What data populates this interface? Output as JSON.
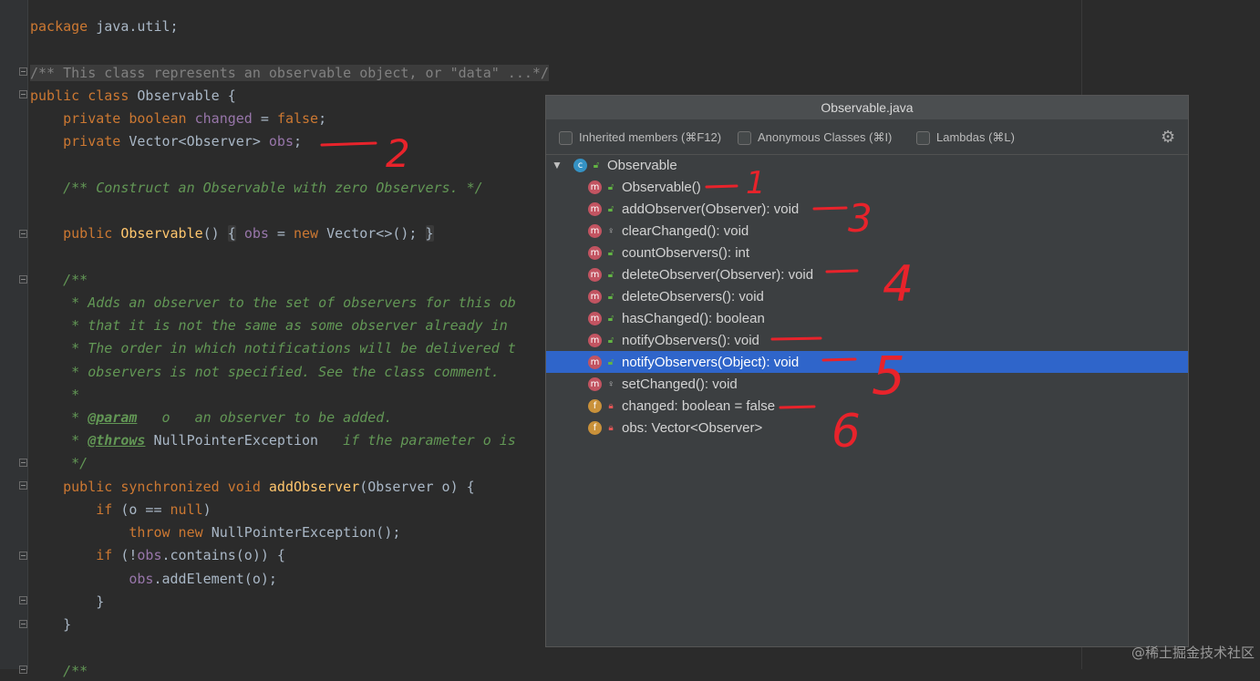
{
  "editor": {
    "lines": [
      {
        "parts": [
          {
            "c": "kw",
            "t": "package "
          },
          {
            "c": "",
            "t": "java.util;"
          }
        ]
      },
      {
        "parts": [
          {
            "c": "cmt cmt-bg",
            "t": "/** This class represents an observable object, or \"data\" ...*/"
          }
        ]
      },
      {
        "parts": [
          {
            "c": "kw",
            "t": "public class "
          },
          {
            "c": "",
            "t": "Observable {"
          }
        ]
      },
      {
        "parts": [
          {
            "c": "",
            "t": "    "
          },
          {
            "c": "kw",
            "t": "private boolean "
          },
          {
            "c": "fld",
            "t": "changed"
          },
          {
            "c": "",
            "t": " = "
          },
          {
            "c": "kw",
            "t": "false"
          },
          {
            "c": "",
            "t": ";"
          }
        ]
      },
      {
        "parts": [
          {
            "c": "",
            "t": "    "
          },
          {
            "c": "kw",
            "t": "private "
          },
          {
            "c": "",
            "t": "Vector<Observer> "
          },
          {
            "c": "fld",
            "t": "obs"
          },
          {
            "c": "",
            "t": ";"
          }
        ]
      },
      {
        "parts": [
          {
            "c": "doc",
            "t": "    /** Construct an Observable with zero Observers. */"
          }
        ]
      },
      {
        "parts": [
          {
            "c": "",
            "t": "    "
          },
          {
            "c": "kw",
            "t": "public "
          },
          {
            "c": "fn",
            "t": "Observable"
          },
          {
            "c": "",
            "t": "() "
          },
          {
            "c": "hl-block",
            "t": "{"
          },
          {
            "c": "",
            "t": " "
          },
          {
            "c": "fld",
            "t": "obs"
          },
          {
            "c": "",
            "t": " = "
          },
          {
            "c": "kw",
            "t": "new "
          },
          {
            "c": "",
            "t": "Vector<>(); "
          },
          {
            "c": "hl-block",
            "t": "}"
          }
        ]
      },
      {
        "parts": [
          {
            "c": "doc",
            "t": "    /**"
          }
        ]
      },
      {
        "parts": [
          {
            "c": "doc",
            "t": "     * Adds an observer to the set of observers for this ob"
          }
        ]
      },
      {
        "parts": [
          {
            "c": "doc",
            "t": "     * that it is not the same as some observer already in"
          }
        ]
      },
      {
        "parts": [
          {
            "c": "doc",
            "t": "     * The order in which notifications will be delivered t"
          }
        ]
      },
      {
        "parts": [
          {
            "c": "doc",
            "t": "     * observers is not specified. See the class comment."
          }
        ]
      },
      {
        "parts": [
          {
            "c": "doc",
            "t": "     *"
          }
        ]
      },
      {
        "parts": [
          {
            "c": "doc",
            "t": "     * "
          },
          {
            "c": "tag",
            "t": "@param"
          },
          {
            "c": "doc",
            "t": "   o   an observer to be added."
          }
        ]
      },
      {
        "parts": [
          {
            "c": "doc",
            "t": "     * "
          },
          {
            "c": "tag",
            "t": "@throws"
          },
          {
            "c": "doc",
            "t": " "
          },
          {
            "c": "",
            "t": "NullPointerException"
          },
          {
            "c": "doc",
            "t": "   if the parameter o is"
          }
        ]
      },
      {
        "parts": [
          {
            "c": "doc",
            "t": "     */"
          }
        ]
      },
      {
        "parts": [
          {
            "c": "",
            "t": "    "
          },
          {
            "c": "kw",
            "t": "public synchronized void "
          },
          {
            "c": "fn",
            "t": "addObserver"
          },
          {
            "c": "",
            "t": "(Observer o) {"
          }
        ]
      },
      {
        "parts": [
          {
            "c": "",
            "t": "        "
          },
          {
            "c": "kw",
            "t": "if "
          },
          {
            "c": "",
            "t": "(o == "
          },
          {
            "c": "kw",
            "t": "null"
          },
          {
            "c": "",
            "t": ")"
          }
        ]
      },
      {
        "parts": [
          {
            "c": "",
            "t": "            "
          },
          {
            "c": "kw",
            "t": "throw new "
          },
          {
            "c": "",
            "t": "NullPointerException();"
          }
        ]
      },
      {
        "parts": [
          {
            "c": "",
            "t": "        "
          },
          {
            "c": "kw",
            "t": "if "
          },
          {
            "c": "",
            "t": "(!"
          },
          {
            "c": "fld",
            "t": "obs"
          },
          {
            "c": "",
            "t": ".contains(o)) {"
          }
        ]
      },
      {
        "parts": [
          {
            "c": "",
            "t": "            "
          },
          {
            "c": "fld",
            "t": "obs"
          },
          {
            "c": "",
            "t": ".addElement(o);"
          }
        ]
      },
      {
        "parts": [
          {
            "c": "",
            "t": "        }"
          }
        ]
      },
      {
        "parts": [
          {
            "c": "",
            "t": "    }"
          }
        ]
      },
      {
        "parts": [
          {
            "c": "doc",
            "t": "    /**"
          }
        ]
      }
    ]
  },
  "popup": {
    "title": "Observable.java",
    "filters": [
      {
        "label": "Inherited members (⌘F12)",
        "checked": false
      },
      {
        "label": "Anonymous Classes (⌘I)",
        "checked": false
      },
      {
        "label": "Lambdas (⌘L)",
        "checked": false
      }
    ],
    "settings_icon": "gear-icon",
    "root": {
      "label": "Observable",
      "kind": "c",
      "expanded": true
    },
    "members": [
      {
        "label": "Observable()",
        "kind": "m",
        "vis": "pub",
        "selected": false
      },
      {
        "label": "addObserver(Observer): void",
        "kind": "m",
        "vis": "pub",
        "selected": false
      },
      {
        "label": "clearChanged(): void",
        "kind": "m",
        "vis": "pro",
        "selected": false
      },
      {
        "label": "countObservers(): int",
        "kind": "m",
        "vis": "pub",
        "selected": false
      },
      {
        "label": "deleteObserver(Observer): void",
        "kind": "m",
        "vis": "pub",
        "selected": false
      },
      {
        "label": "deleteObservers(): void",
        "kind": "m",
        "vis": "pub",
        "selected": false
      },
      {
        "label": "hasChanged(): boolean",
        "kind": "m",
        "vis": "pub",
        "selected": false
      },
      {
        "label": "notifyObservers(): void",
        "kind": "m",
        "vis": "pub",
        "selected": false
      },
      {
        "label": "notifyObservers(Object): void",
        "kind": "m",
        "vis": "pub",
        "selected": true
      },
      {
        "label": "setChanged(): void",
        "kind": "m",
        "vis": "pro",
        "selected": false
      },
      {
        "label": "changed: boolean = false",
        "kind": "f",
        "vis": "pri",
        "selected": false
      },
      {
        "label": "obs: Vector<Observer>",
        "kind": "f",
        "vis": "pri",
        "selected": false
      }
    ]
  },
  "annotations": [
    "1",
    "2",
    "3",
    "4",
    "5",
    "6"
  ],
  "watermark": "@稀土掘金技术社区",
  "colors": {
    "annotation": "#e8232b",
    "selection": "#2f65ca"
  }
}
